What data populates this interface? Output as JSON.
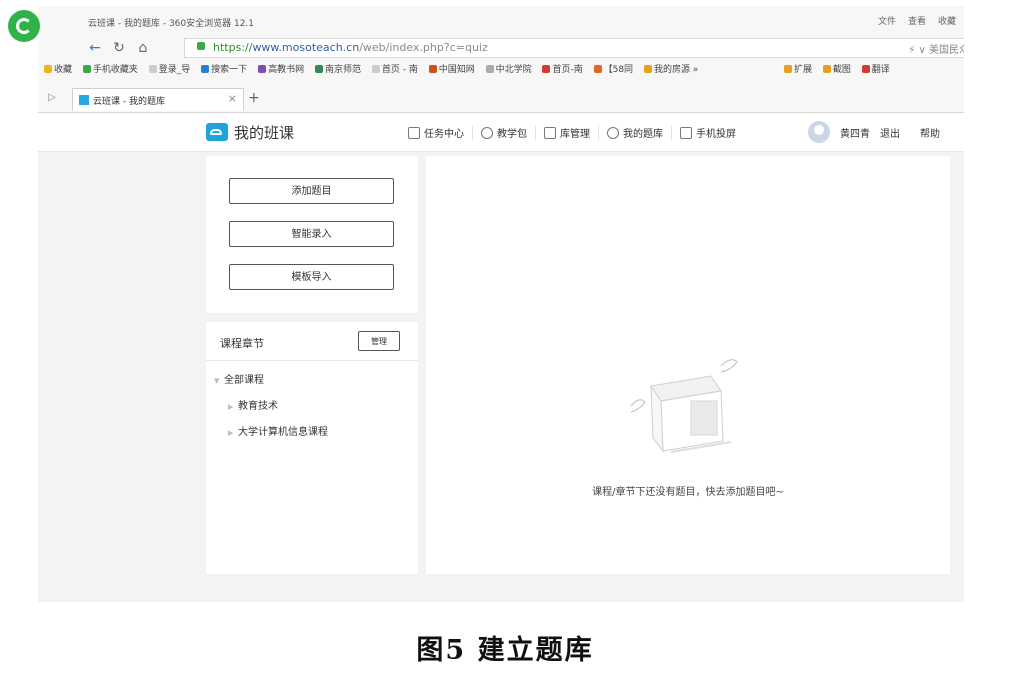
{
  "browser": {
    "window_title": "云班课 - 我的题库 - 360安全浏览器 12.1",
    "menu": [
      "文件",
      "查看",
      "收藏"
    ],
    "url_scheme": "https://",
    "url_host": "www.mosoteach.cn",
    "url_path": "/web/index.php?c=quiz",
    "address_right": "美国民众",
    "bookmarks": [
      "收藏",
      "手机收藏夹",
      "登录_导",
      "搜索一下",
      "高教书网",
      "南京师范",
      "首页 - 南",
      "中国知网",
      "中北学院",
      "首页-南",
      "【58同",
      "我的房源 »"
    ],
    "bookmarks_right": [
      "扩展",
      "截图",
      "翻译"
    ],
    "tab_title": "云班课 - 我的题库"
  },
  "site": {
    "brand": "我的班课",
    "nav": [
      {
        "label": "任务中心",
        "icon": "task-icon"
      },
      {
        "label": "教学包",
        "icon": "package-icon"
      },
      {
        "label": "库管理",
        "icon": "library-icon"
      },
      {
        "label": "我的题库",
        "icon": "layers-icon"
      },
      {
        "label": "手机投屏",
        "icon": "screen-icon"
      }
    ],
    "user_name": "黄四青",
    "logout": "退出",
    "help": "帮助"
  },
  "left": {
    "buttons": [
      "添加题目",
      "智能录入",
      "模板导入"
    ],
    "chapter_title": "课程章节",
    "manage_label": "管理",
    "tree": {
      "root": "全部课程",
      "children": [
        "教育技术",
        "大学计算机信息课程"
      ]
    }
  },
  "main": {
    "empty_message": "课程/章节下还没有题目，快去添加题目吧~"
  },
  "caption": "图5  建立题库"
}
